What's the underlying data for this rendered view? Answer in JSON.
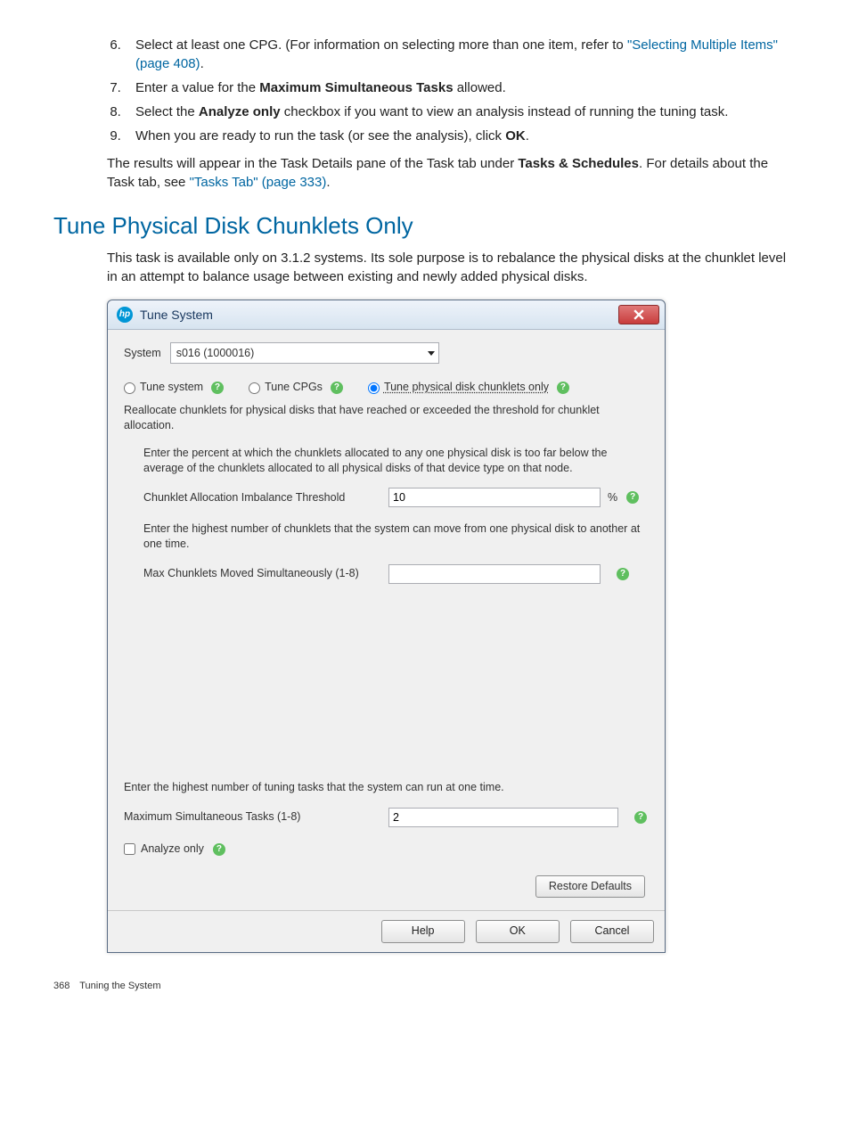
{
  "list": {
    "start": 6,
    "items": [
      {
        "prefix": "Select at least one CPG. (For information on selecting more than one item, refer to ",
        "link": "\"Selecting Multiple Items\" (page 408)",
        "suffix": "."
      },
      {
        "prefix": "Enter a value for the ",
        "bold": "Maximum Simultaneous Tasks",
        "suffix": " allowed."
      },
      {
        "prefix": "Select the ",
        "bold": "Analyze only",
        "suffix": " checkbox if you want to view an analysis instead of running the tuning task."
      },
      {
        "prefix": "When you are ready to run the task (or see the analysis), click ",
        "bold": "OK",
        "suffix": "."
      }
    ]
  },
  "para1_a": "The results will appear in the Task Details pane of the Task tab under ",
  "para1_bold": "Tasks & Schedules",
  "para1_b": ". For details about the Task tab, see ",
  "para1_link": "\"Tasks Tab\" (page 333)",
  "para1_c": ".",
  "section_heading": "Tune Physical Disk Chunklets Only",
  "section_intro": "This task is available only on 3.1.2 systems. Its sole purpose is to rebalance the physical disks at the chunklet level in an attempt to balance usage between existing and newly added physical disks.",
  "dialog": {
    "title": "Tune System",
    "system_label": "System",
    "system_value": "s016 (1000016)",
    "radio_tune_system": "Tune system",
    "radio_tune_cpgs": "Tune CPGs",
    "radio_tune_chunklets": "Tune physical disk chunklets only",
    "selected_radio": "chunklets",
    "realloc_desc": "Reallocate chunklets for physical disks that have reached or exceeded the threshold for chunklet allocation.",
    "pct_desc": "Enter the percent at which the chunklets allocated to any one physical disk is too far below the average of the chunklets allocated to all physical disks of that device type on that node.",
    "threshold_label": "Chunklet Allocation Imbalance Threshold",
    "threshold_value": "10",
    "pct_sign": "%",
    "maxchunk_desc": "Enter the highest number of chunklets that the system can move from one physical disk to another at one time.",
    "maxchunk_label": "Max Chunklets Moved Simultaneously (1-8)",
    "maxchunk_value": "",
    "maxtasks_desc": "Enter the highest number of tuning tasks that the system can run at one time.",
    "maxtasks_label": "Maximum Simultaneous Tasks (1-8)",
    "maxtasks_value": "2",
    "analyze_only": "Analyze only",
    "restore_defaults": "Restore Defaults",
    "help": "Help",
    "ok": "OK",
    "cancel": "Cancel"
  },
  "footer_page": "368",
  "footer_title": "Tuning the System"
}
